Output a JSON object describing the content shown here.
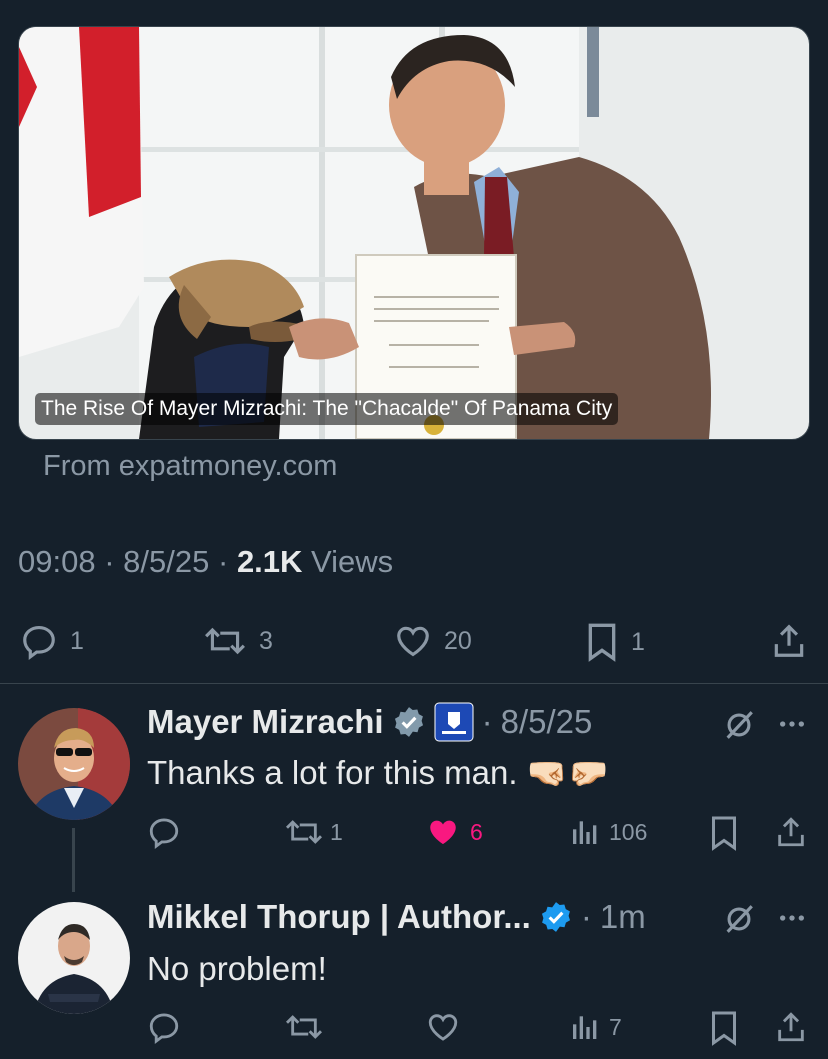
{
  "card": {
    "caption": "The Rise Of Mayer Mizrachi: The \"Chacalde\" Of Panama City",
    "source": "From expatmoney.com"
  },
  "post_meta": {
    "time": "09:08",
    "date": "8/5/25",
    "views_count": "2.1K",
    "views_label": "Views"
  },
  "post_actions": {
    "replies": "1",
    "reposts": "3",
    "likes": "20",
    "bookmarks": "1"
  },
  "replies": [
    {
      "name": "Mayer Mizrachi",
      "date": "8/5/25",
      "text": "Thanks a lot for this man. 🤜🏻🤛🏻",
      "reposts": "1",
      "likes": "6",
      "views": "106"
    },
    {
      "name": "Mikkel Thorup | Author...",
      "date": "1m",
      "text": "No problem!",
      "reposts": "",
      "likes": "",
      "views": "7"
    }
  ],
  "colors": {
    "background": "#15202b",
    "secondary_text": "#8b98a5",
    "verified_blue": "#1d9bf0",
    "verified_gray": "#829aab",
    "like_pink": "#f91880"
  },
  "separators": {
    "dot": "·"
  }
}
